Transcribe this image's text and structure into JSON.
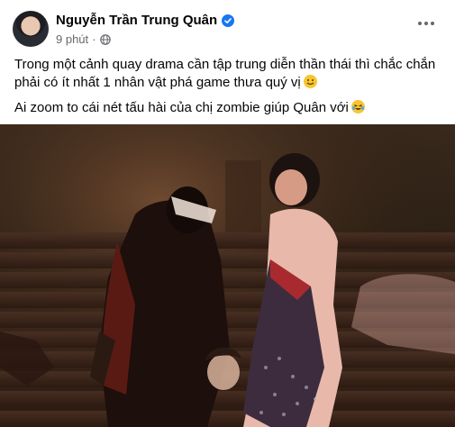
{
  "post": {
    "author": "Nguyễn Trần Trung Quân",
    "time": "9 phút",
    "separator": "·",
    "lines": [
      "Trong một cảnh quay drama cần tập trung diễn thần thái thì chắc chắn phải có ít nhất 1 nhân vật phá game thưa quý vị",
      "Ai zoom to cái nét tấu hài của chị zombie giúp Quân với"
    ]
  },
  "icons": {
    "avatar": "avatar",
    "verified": "verified-badge-icon",
    "privacy": "globe-icon",
    "more": "more-options-icon",
    "emoji1": "smiling-face-emoji",
    "emoji2": "laughing-face-emoji"
  },
  "colors": {
    "verified": "#1877f2",
    "meta_text": "#65676b",
    "text": "#050505"
  }
}
